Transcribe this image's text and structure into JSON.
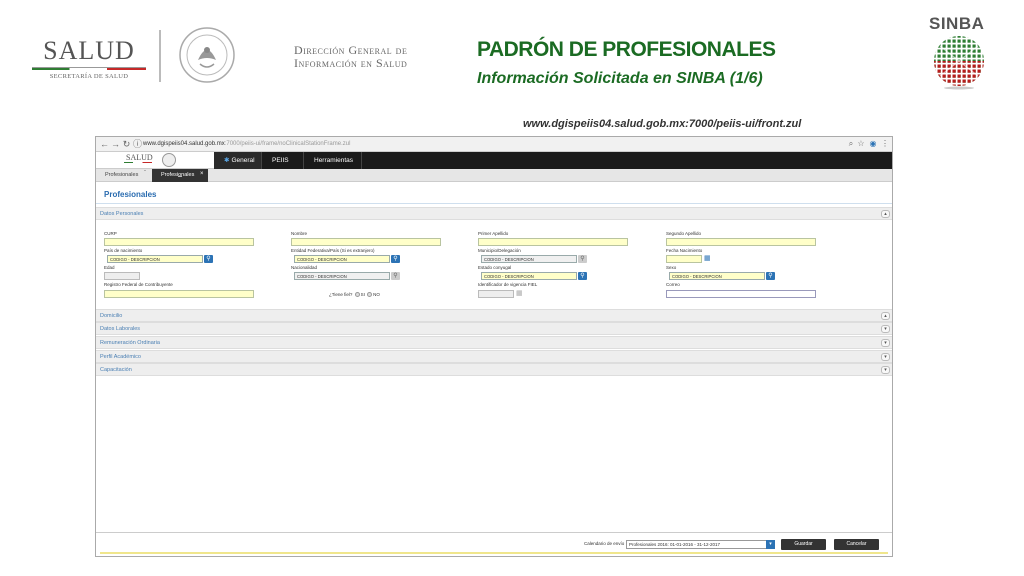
{
  "slide": {
    "salud": "SALUD",
    "salud_sub": "SECRETARÍA DE SALUD",
    "dgis_line1": "Dirección General de",
    "dgis_line2": "Información en Salud",
    "title": "PADRÓN DE PROFESIONALES",
    "subtitle": "Información Solicitada en SINBA (1/6)",
    "sinba": "SINBA",
    "url_caption": "www.dgispeiis04.salud.gob.mx:7000/peiis-ui/front.zul"
  },
  "browser": {
    "url_host": "www.dgispeiis04.salud.gob.mx",
    "url_path": ":7000/peiis-ui/frame/noClinicalStationFrame.zul"
  },
  "app": {
    "logo": "SALUD",
    "menu": [
      "General",
      "PEIIS",
      "Herramientas"
    ],
    "tabs": [
      "Profesionales",
      "Profesionales"
    ],
    "page_title": "Profesionales"
  },
  "sections": {
    "datos_personales": "Datos Personales",
    "domicilio": "Domicilio",
    "datos_laborales": "Datos Laborales",
    "remuneracion": "Remuneración Ordinaria",
    "perfil": "Perfil Académico",
    "capacitacion": "Capacitación"
  },
  "form": {
    "curp": "CURP",
    "nombre": "Nombre",
    "primer_apellido": "Primer Apellido",
    "segundo_apellido": "Segundo Apellido",
    "pais_nacimiento": "País de nacimiento",
    "entidad": "Entidad Federativa/País (Si es extranjero)",
    "municipio": "Municipio/Delegación",
    "fecha_nacimiento": "Fecha Nacimiento",
    "edad": "Edad",
    "nacionalidad": "Nacionalidad",
    "estado_conyugal": "Estado conyugal",
    "sexo": "Sexo",
    "rfc": "Registro Federal de Contribuyente",
    "tiene_fiel": "¿Tiene fiel?",
    "si": "SI",
    "no": "NO",
    "identificador_fiel": "Identificador de vigencia FIEL",
    "correo": "Correo",
    "placeholder": "CODIGO - DESCRIPCION"
  },
  "footer": {
    "label": "Calendario de envío",
    "select_value": "Profesionales 2016: 01-01-2016 - 31-12-2017",
    "guardar": "Guardar",
    "cancelar": "Cancelar"
  },
  "colors": {
    "title_green": "#1b6b23",
    "link_blue": "#4a7fb3",
    "required_yellow": "#ffffc9"
  }
}
